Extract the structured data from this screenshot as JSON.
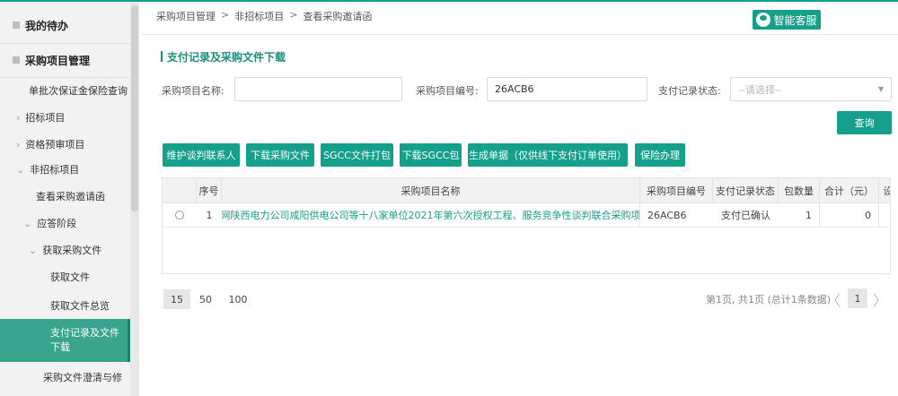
{
  "sidebar": {
    "items": [
      {
        "label": "我的待办"
      },
      {
        "label": "采购项目管理"
      },
      {
        "label": "单批次保证金保险查询"
      },
      {
        "label": "招标项目"
      },
      {
        "label": "资格预审项目"
      },
      {
        "label": "非招标项目"
      },
      {
        "label": "查看采购邀请函"
      },
      {
        "label": "应答阶段"
      },
      {
        "label": "获取采购文件"
      },
      {
        "label": "获取文件"
      },
      {
        "label": "获取文件总览"
      },
      {
        "label": "支付记录及文件下载"
      },
      {
        "label": "采购文件澄清与修"
      }
    ],
    "active_color": "#3aa58e"
  },
  "breadcrumb": [
    "采购项目管理",
    "非招标项目",
    "查看采购邀请函"
  ],
  "breadcrumb_sep": ">",
  "customer_service": "智能客服",
  "section_title": "支付记录及采购文件下载",
  "filters": {
    "name_label": "采购项目名称:",
    "name_value": "",
    "code_label": "采购项目编号:",
    "code_value": "26ACB6",
    "status_label": "支付记录状态:",
    "status_placeholder": "--请选择--"
  },
  "query_button": "查询",
  "toolbar": [
    "维护谈判联系人",
    "下载采购文件",
    "SGCC文件打包",
    "下载SGCC包",
    "生成单据（仅供线下支付订单使用）",
    "保险办理"
  ],
  "table": {
    "columns": [
      "序号",
      "采购项目名称",
      "采购项目编号",
      "支付记录状态",
      "包数量",
      "合计（元）",
      "设"
    ],
    "rows": [
      {
        "index": "1",
        "name": "国网陕西电力公司咸阳供电公司等十八家单位2021年第六次授权工程、服务竞争性谈判联合采购项目",
        "code": "26ACB6",
        "status": "支付已确认",
        "packages": "1",
        "total": "0"
      }
    ]
  },
  "pagination": {
    "sizes": [
      "15",
      "50",
      "100"
    ],
    "info": "第1页, 共1页 (总计1条数据)",
    "current_page": "1",
    "prev": "〈",
    "next": "〉"
  },
  "colors": {
    "accent": "#14a08a"
  }
}
